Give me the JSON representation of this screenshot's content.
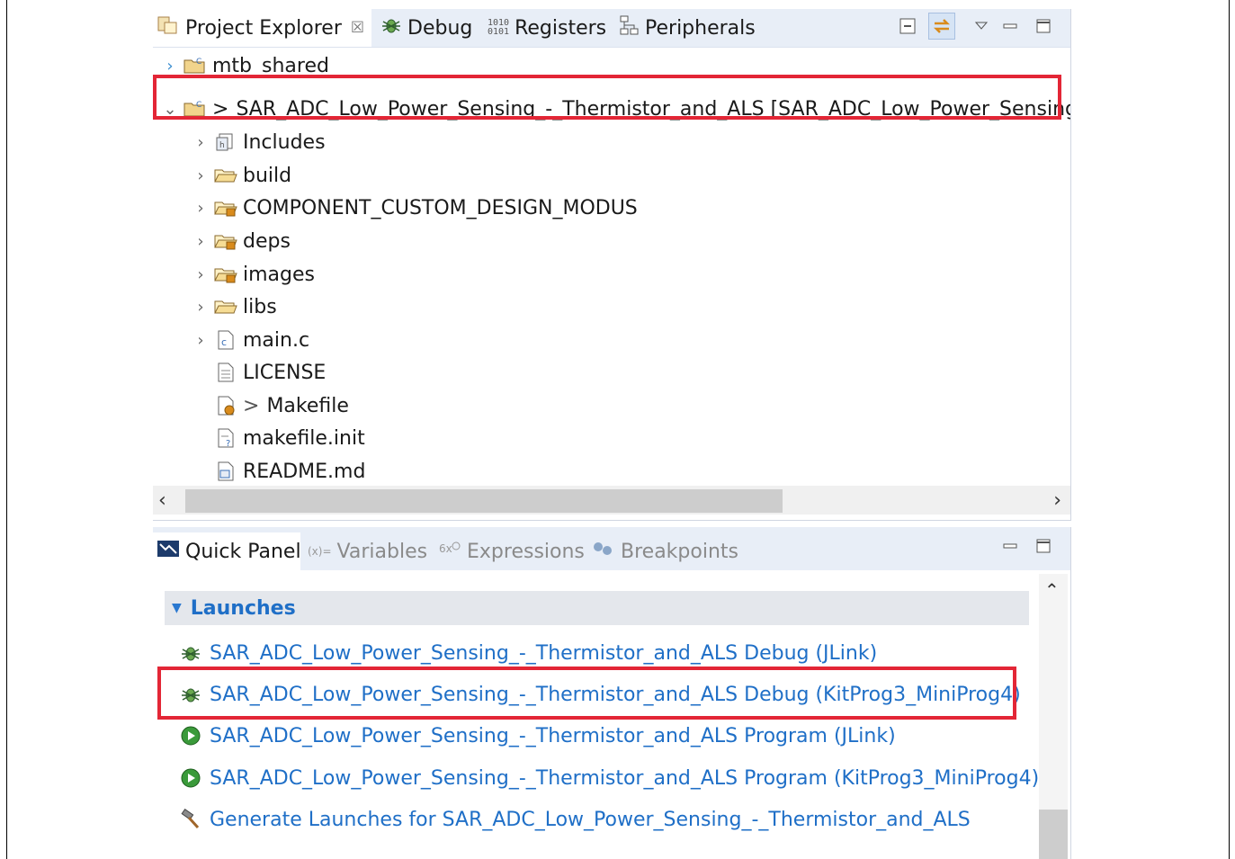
{
  "project_explorer": {
    "tabs": [
      {
        "label": "Project Explorer",
        "icon": "project-explorer-icon",
        "active": true,
        "close": "☒"
      },
      {
        "label": "Debug",
        "icon": "bug-icon"
      },
      {
        "label": "Registers",
        "icon": "registers-icon"
      },
      {
        "label": "Peripherals",
        "icon": "peripherals-icon"
      }
    ],
    "toolbar": [
      "collapse-all-icon",
      "link-with-editor-icon",
      "view-menu-icon",
      "minimize-icon",
      "maximize-icon"
    ],
    "tree": [
      {
        "label": "mtb_shared",
        "icon": "project-folder-icon",
        "expanded": false
      },
      {
        "label": "SAR_ADC_Low_Power_Sensing_-_Thermistor_and_ALS [SAR_ADC_Low_Power_Sensing_",
        "prefix": ">",
        "icon": "project-folder-icon",
        "expanded": true,
        "highlighted": true
      },
      {
        "label": "Includes",
        "icon": "includes-icon",
        "expanded": false
      },
      {
        "label": "build",
        "icon": "folder-icon",
        "expanded": false
      },
      {
        "label": "COMPONENT_CUSTOM_DESIGN_MODUS",
        "icon": "package-folder-icon",
        "expanded": false
      },
      {
        "label": "deps",
        "icon": "package-folder-icon",
        "expanded": false
      },
      {
        "label": "images",
        "icon": "package-folder-icon",
        "expanded": false
      },
      {
        "label": "libs",
        "icon": "folder-icon",
        "expanded": false
      },
      {
        "label": "main.c",
        "icon": "c-file-icon",
        "expanded": false
      },
      {
        "label": "LICENSE",
        "icon": "text-file-icon"
      },
      {
        "label": "Makefile",
        "prefix": ">",
        "icon": "makefile-icon"
      },
      {
        "label": "makefile.init",
        "icon": "unknown-file-icon"
      },
      {
        "label": "README.md",
        "icon": "markdown-file-icon"
      }
    ]
  },
  "quick_panel": {
    "tabs": [
      {
        "label": "Quick Panel",
        "icon": "quick-panel-icon",
        "active": true
      },
      {
        "label": "Variables",
        "icon": "variables-icon",
        "prefix": "(x)="
      },
      {
        "label": "Expressions",
        "icon": "expressions-icon"
      },
      {
        "label": "Breakpoints",
        "icon": "breakpoints-icon"
      }
    ],
    "section_title": "Launches",
    "launches": [
      {
        "label": "SAR_ADC_Low_Power_Sensing_-_Thermistor_and_ALS Debug (JLink)",
        "icon": "bug-icon"
      },
      {
        "label": "SAR_ADC_Low_Power_Sensing_-_Thermistor_and_ALS Debug (KitProg3_MiniProg4)",
        "icon": "bug-icon",
        "highlighted": true
      },
      {
        "label": "SAR_ADC_Low_Power_Sensing_-_Thermistor_and_ALS Program (JLink)",
        "icon": "run-icon"
      },
      {
        "label": "SAR_ADC_Low_Power_Sensing_-_Thermistor_and_ALS Program (KitProg3_MiniProg4)",
        "icon": "run-icon"
      },
      {
        "label": "Generate Launches for SAR_ADC_Low_Power_Sensing_-_Thermistor_and_ALS",
        "icon": "hammer-icon"
      }
    ]
  },
  "colors": {
    "highlight": "#e32636",
    "link": "#1f6fc7",
    "tabbar": "#e8eef7"
  }
}
